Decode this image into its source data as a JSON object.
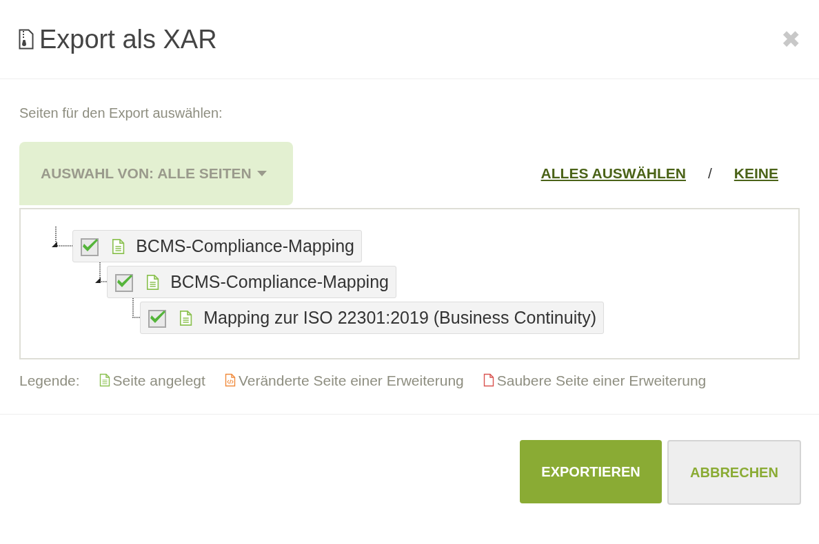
{
  "dialog": {
    "title": "Export als XAR",
    "close": "✖"
  },
  "prompt": "Seiten für den Export auswählen:",
  "selector": {
    "label": "AUSWAHL VON: ALLE SEITEN"
  },
  "select_links": [
    {
      "kind": "link",
      "text": "ALLES AUSWÄHLEN"
    },
    {
      "kind": "separator",
      "text": "/"
    },
    {
      "kind": "link",
      "text": "KEINE"
    }
  ],
  "tree": [
    {
      "label": "BCMS-Compliance-Mapping",
      "checked": true,
      "expanded": true,
      "children": [
        {
          "label": "BCMS-Compliance-Mapping",
          "checked": true,
          "expanded": true,
          "children": [
            {
              "label": "Mapping zur ISO 22301:2019 (Business Continuity)",
              "checked": true,
              "expanded": false
            }
          ]
        }
      ]
    }
  ],
  "legend": {
    "label": "Legende:",
    "items": [
      {
        "kind": "created",
        "text": "Seite angelegt"
      },
      {
        "kind": "modified",
        "text": "Veränderte Seite einer Erweiterung"
      },
      {
        "kind": "clean",
        "text": "Saubere Seite einer Erweiterung"
      }
    ]
  },
  "buttons": [
    {
      "kind": "primary",
      "text": "EXPORTIEREN"
    },
    {
      "kind": "secondary",
      "text": "ABBRECHEN"
    }
  ]
}
